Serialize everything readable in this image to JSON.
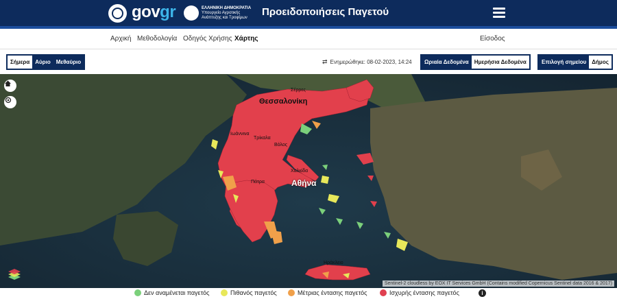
{
  "header": {
    "logo_text_main": "gov",
    "logo_text_accent": "gr",
    "ministry_line1": "ΕΛΛΗΝΙΚΗ ΔΗΜΟΚΡΑΤΙΑ",
    "ministry_line2": "Υπουργείο Αγροτικής Ανάπτυξης και Τροφίμων",
    "title": "Προειδοποιήσεις Παγετού",
    "menu_icon": "hamburger-menu-icon"
  },
  "nav": {
    "items": [
      {
        "label": "Αρχική"
      },
      {
        "label": "Μεθοδολογία"
      },
      {
        "label": "Οδηγός Χρήσης"
      },
      {
        "label": "Χάρτης"
      }
    ],
    "login_label": "Είσοδος"
  },
  "controls": {
    "days": [
      {
        "label": "Σήμερα",
        "selected": false
      },
      {
        "label": "Αύριο",
        "selected": false
      },
      {
        "label": "Μεθαύριο",
        "selected": false
      }
    ],
    "updated_text": "Ενημερώθηκε: 08-02-2023, 14:24",
    "data_types": [
      {
        "label": "Ωριαία Δεδομένα",
        "selected": false
      },
      {
        "label": "Ημερήσια Δεδομένα",
        "selected": true
      }
    ],
    "point_select_label": "Επιλογή σημείου",
    "municipality_label": "Δήμος"
  },
  "map": {
    "labels": {
      "serres": "Σέρρες",
      "thessaloniki": "Θεσσαλονίκη",
      "ioannina": "Ιωάννινα",
      "trikala": "Τρίκαλα",
      "volos": "Βόλος",
      "chalkida": "Χαλκίδα",
      "patra": "Πάτρα",
      "athina": "Αθήνα",
      "irakleio": "Ηράκλειο"
    },
    "attribution": "Sentinel-2 cloudless by EOX IT Services GmbH (Contains modified Copernicus Sentinel data 2016 & 2017)",
    "icons": [
      "home-icon",
      "locate-icon",
      "layers-icon"
    ]
  },
  "legend": {
    "items": [
      {
        "label": "Δεν αναμένεται παγετός",
        "color": "#7bd07b"
      },
      {
        "label": "Πιθανός παγετός",
        "color": "#e8e85a"
      },
      {
        "label": "Μέτριας έντασης παγετός",
        "color": "#f0a04a"
      },
      {
        "label": "Ισχυρής έντασης παγετός",
        "color": "#e04050"
      }
    ],
    "info_icon": "info-icon"
  }
}
